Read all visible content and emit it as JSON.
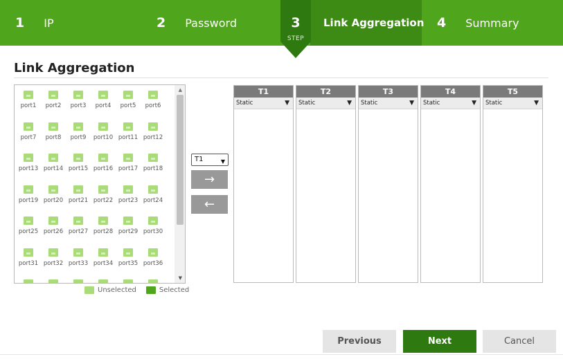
{
  "steps": [
    {
      "num": "1",
      "label": "IP"
    },
    {
      "num": "2",
      "label": "Password"
    },
    {
      "num": "3",
      "label": "Link Aggregation",
      "sub": "STEP"
    },
    {
      "num": "4",
      "label": "Summary"
    }
  ],
  "page_title": "Link Aggregation",
  "ports": [
    "port1",
    "port2",
    "port3",
    "port4",
    "port5",
    "port6",
    "port7",
    "port8",
    "port9",
    "port10",
    "port11",
    "port12",
    "port13",
    "port14",
    "port15",
    "port16",
    "port17",
    "port18",
    "port19",
    "port20",
    "port21",
    "port22",
    "port23",
    "port24",
    "port25",
    "port26",
    "port27",
    "port28",
    "port29",
    "port30",
    "port31",
    "port32",
    "port33",
    "port34",
    "port35",
    "port36",
    "",
    "",
    "",
    "",
    "",
    ""
  ],
  "legend": {
    "unselected": "Unselected",
    "selected": "Selected"
  },
  "trunk_select": {
    "value": "T1"
  },
  "move_right": "→",
  "move_left": "←",
  "trunks": [
    {
      "name": "T1",
      "mode": "Static"
    },
    {
      "name": "T2",
      "mode": "Static"
    },
    {
      "name": "T3",
      "mode": "Static"
    },
    {
      "name": "T4",
      "mode": "Static"
    },
    {
      "name": "T5",
      "mode": "Static"
    }
  ],
  "buttons": {
    "previous": "Previous",
    "next": "Next",
    "cancel": "Cancel"
  },
  "colors": {
    "step_bar": "#4fa51b",
    "step_active": "#3d8a14",
    "next_button": "#2f7a10",
    "port_unselected": "#a9dc78",
    "port_selected": "#4fa51b"
  }
}
